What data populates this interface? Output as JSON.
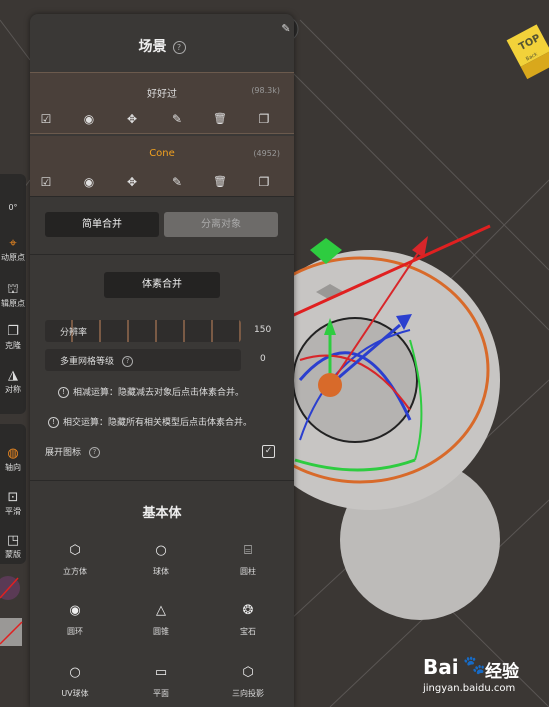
{
  "panel": {
    "title": "场景",
    "help_glyph": "?",
    "pin_glyph": "✎"
  },
  "objects": [
    {
      "name": "好好过",
      "count": "(98.3k)",
      "checkbox": "☑",
      "eye": "◉",
      "move": "✥",
      "edit": "✎",
      "delete": "🗑",
      "copy": "❐"
    },
    {
      "name": "Cone",
      "count": "(4952)",
      "checkbox": "☑",
      "eye": "◉",
      "move": "✥",
      "edit": "✎",
      "delete": "🗑",
      "copy": "❐",
      "name_color": "#f0a020"
    }
  ],
  "merge": {
    "simple_merge": "简单合并",
    "separate_objects": "分离对象",
    "voxel_merge": "体素合并",
    "resolution_label": "分辨率",
    "resolution_value": "150",
    "multires_label": "多重网格等级",
    "multires_value": "0",
    "note_subtract": "相减运算：隐藏减去对象后点击体素合并。",
    "note_intersect": "相交运算：隐藏所有相关模型后点击体素合并。",
    "expand_icons_label": "展开图标",
    "expand_icons_checked": "✓"
  },
  "primitives": {
    "title": "基本体",
    "items": [
      {
        "label": "立方体",
        "icon": "⬡"
      },
      {
        "label": "球体",
        "icon": "○"
      },
      {
        "label": "圆柱",
        "icon": "⌸"
      },
      {
        "label": "圆环",
        "icon": "◉"
      },
      {
        "label": "圆锥",
        "icon": "△"
      },
      {
        "label": "宝石",
        "icon": "❂"
      },
      {
        "label": "UV球体",
        "icon": "○"
      },
      {
        "label": "平面",
        "icon": "▭"
      },
      {
        "label": "三向投影",
        "icon": "⬡"
      }
    ]
  },
  "left_tools": {
    "angle": "0°",
    "items": [
      {
        "label": "动原点",
        "icon": "⌖"
      },
      {
        "label": "辑原点",
        "icon": "⛫"
      },
      {
        "label": "克隆",
        "icon": "❐"
      },
      {
        "label": "对称",
        "icon": "◮"
      },
      {
        "label": "轴向",
        "icon": "◍"
      },
      {
        "label": "平滑",
        "icon": "⊡"
      },
      {
        "label": "蒙版",
        "icon": "◳"
      }
    ]
  },
  "nav_cube": {
    "label": "TOP",
    "sub": "Back"
  },
  "watermark": {
    "brand": "Bai",
    "brand_cn": "经验",
    "url": "jingyan.baidu.com"
  },
  "colors": {
    "accent_orange": "#f0a020",
    "gizmo_green": "#2ecc40",
    "gizmo_blue": "#2b3fcf",
    "gizmo_red": "#d8262a",
    "ring_orange": "#d86a2a",
    "arrow_red": "#e02020"
  }
}
